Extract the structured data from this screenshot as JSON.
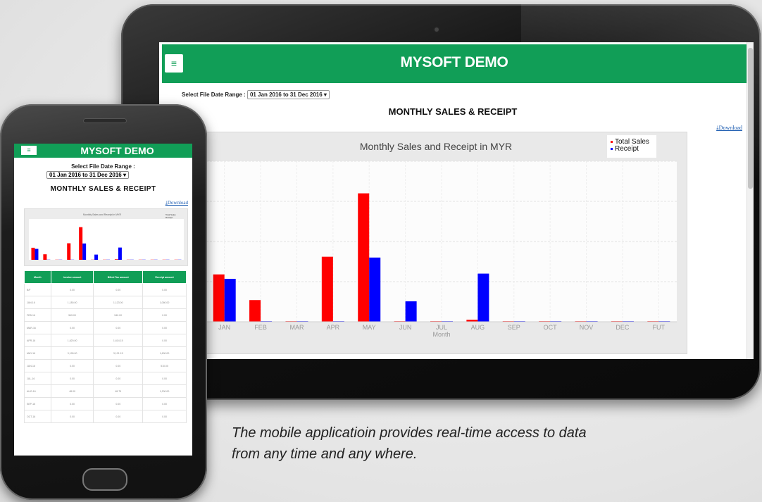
{
  "tablet": {
    "app_title": "MYSOFT DEMO",
    "menu_icon": "≡",
    "range_label": "Select File Date Range :",
    "range_value": "01 Jan 2016 to 31 Dec 2016 ▾",
    "report_title": "MONTHLY SALES & RECEIPT",
    "download_label": "⤓Download"
  },
  "chart_data": {
    "type": "bar",
    "title": "Monthly Sales and Receipt in MYR",
    "xlabel": "Month",
    "ylabel": "",
    "categories": [
      "JAN",
      "FEB",
      "MAR",
      "APR",
      "MAY",
      "JUN",
      "JUL",
      "AUG",
      "SEP",
      "OCT",
      "NOV",
      "DEC",
      "FUT"
    ],
    "ylim": [
      0,
      4000
    ],
    "yticks": [
      "0",
      "1000",
      "2000",
      "3000",
      "4000"
    ],
    "series": [
      {
        "name": "Total Sales",
        "color": "#ff0000",
        "values": [
          1180,
          540,
          15,
          1620,
          3200,
          15,
          15,
          50,
          15,
          15,
          15,
          15,
          15
        ]
      },
      {
        "name": "Receipt",
        "color": "#0000ff",
        "values": [
          1070,
          15,
          15,
          15,
          1600,
          510,
          15,
          1200,
          15,
          15,
          15,
          15,
          15
        ]
      }
    ],
    "legend_position": "top-right",
    "grid": true
  },
  "phone": {
    "app_title": "MYSOFT DEMO",
    "menu_icon": "≡",
    "range_label": "Select File Date Range :",
    "range_value": "01 Jan 2016 to 31 Dec 2016 ▾",
    "report_title": "MONTHLY SALES & RECEIPT",
    "download_label": "⤓Download",
    "table_headers": [
      "Month",
      "Invoice amount",
      "Billed Tax amount",
      "Receipt amount"
    ],
    "table_rows": [
      [
        "B/F",
        "0.00",
        "0.00",
        "0.00"
      ],
      [
        "JAN-16",
        "1,180.00",
        "1,123.00",
        "1,060.00"
      ],
      [
        "FEB-16",
        "545.00",
        "540.00",
        "0.00"
      ],
      [
        "MAR-16",
        "0.00",
        "0.00",
        "0.00"
      ],
      [
        "APR-16",
        "1,620.00",
        "1,614.15",
        "0.00"
      ],
      [
        "MAY-16",
        "3,195.00",
        "3,121.15",
        "1,600.00"
      ],
      [
        "JUN-16",
        "0.00",
        "0.00",
        "510.00"
      ],
      [
        "JUL-16",
        "0.00",
        "0.00",
        "0.00"
      ],
      [
        "AUG-16",
        "48.00",
        "48.75",
        "1,200.00"
      ],
      [
        "SEP-16",
        "0.00",
        "0.00",
        "0.00"
      ],
      [
        "OCT-16",
        "0.00",
        "0.00",
        "0.00"
      ]
    ]
  },
  "caption": {
    "line1": "The mobile applicatioin provides real-time access to data",
    "line2": "from any time and any where."
  }
}
